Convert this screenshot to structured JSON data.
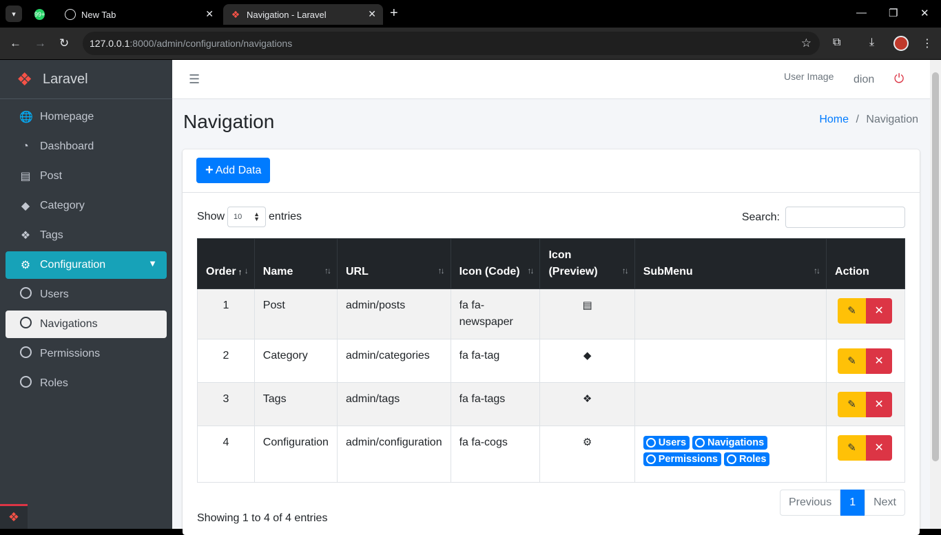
{
  "browser": {
    "tabs": [
      {
        "title": "New Tab",
        "favicon": "globe-icon"
      },
      {
        "title": "Navigation - Laravel",
        "favicon": "laravel-icon",
        "active": true
      }
    ],
    "whatsapp_badge": "99+",
    "url_host": "127.0.0.1",
    "url_path": ":8000/admin/configuration/navigations"
  },
  "sidebar": {
    "brand": "Laravel",
    "items": [
      {
        "label": "Homepage",
        "icon": "globe-icon"
      },
      {
        "label": "Dashboard",
        "icon": "tachometer-icon"
      },
      {
        "label": "Post",
        "icon": "newspaper-icon"
      },
      {
        "label": "Category",
        "icon": "tag-icon"
      },
      {
        "label": "Tags",
        "icon": "tags-icon"
      },
      {
        "label": "Configuration",
        "icon": "cogs-icon"
      },
      {
        "label": "Users",
        "icon": "circle-icon"
      },
      {
        "label": "Navigations",
        "icon": "circle-icon"
      },
      {
        "label": "Permissions",
        "icon": "circle-icon"
      },
      {
        "label": "Roles",
        "icon": "circle-icon"
      }
    ]
  },
  "header": {
    "user_image_alt": "User Image",
    "user_name": "dion"
  },
  "page": {
    "title": "Navigation",
    "breadcrumb_home": "Home",
    "breadcrumb_sep": "/",
    "breadcrumb_current": "Navigation"
  },
  "card": {
    "add_label": "Add Data",
    "show_label": "Show",
    "entries_value": "10",
    "entries_label": "entries",
    "search_label": "Search:",
    "columns": [
      "Order",
      "Name",
      "URL",
      "Icon (Code)",
      "Icon (Preview)",
      "SubMenu",
      "Action"
    ],
    "rows": [
      {
        "order": "1",
        "name": "Post",
        "url": "admin/posts",
        "icon_code": "fa fa-newspaper",
        "icon_preview": "newspaper-icon",
        "submenu": []
      },
      {
        "order": "2",
        "name": "Category",
        "url": "admin/categories",
        "icon_code": "fa fa-tag",
        "icon_preview": "tag-icon",
        "submenu": []
      },
      {
        "order": "3",
        "name": "Tags",
        "url": "admin/tags",
        "icon_code": "fa fa-tags",
        "icon_preview": "tags-icon",
        "submenu": []
      },
      {
        "order": "4",
        "name": "Configuration",
        "url": "admin/configuration",
        "icon_code": "fa fa-cogs",
        "icon_preview": "cogs-icon",
        "submenu": [
          "Users",
          "Navigations",
          "Permissions",
          "Roles"
        ]
      }
    ],
    "info": "Showing 1 to 4 of 4 entries",
    "pager": {
      "prev": "Previous",
      "page": "1",
      "next": "Next"
    }
  },
  "colors": {
    "accent": "#007bff",
    "sidebar_active": "#17a2b8",
    "edit": "#ffc107",
    "delete": "#dc3545",
    "sidebar_bg": "#343a40"
  }
}
